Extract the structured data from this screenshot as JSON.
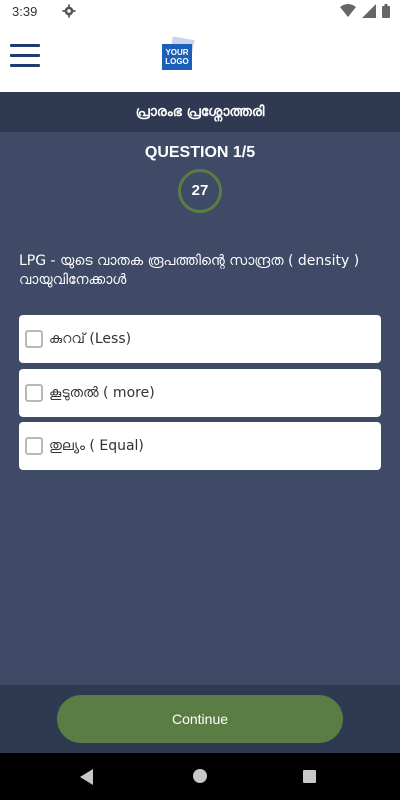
{
  "status_bar": {
    "time": "3:39",
    "icons": [
      "settings-gear-icon",
      "wifi-icon",
      "signal-icon",
      "battery-icon"
    ]
  },
  "header": {
    "menu_icon": "hamburger-menu-icon",
    "logo_text": "YOUR LOGO"
  },
  "title_bar": {
    "title": "പ്രാരംഭ പ്രശ്നോത്തരി"
  },
  "quiz": {
    "question_label": "QUESTION 1/5",
    "timer_value": "27",
    "question_text": "LPG - യുടെ വാതക രൂപത്തിന്റെ സാന്ദ്രത ( density ) വായുവിനേക്കാൾ",
    "options": [
      {
        "label": "കുറവ്  (Less)",
        "checked": false
      },
      {
        "label": "കൂടുതൽ  ( more)",
        "checked": false
      },
      {
        "label": "തുല്യം ( Equal)",
        "checked": false
      }
    ]
  },
  "footer": {
    "continue_label": "Continue"
  },
  "colors": {
    "content_bg": "#3f4a66",
    "title_bar_bg": "#2f3a52",
    "accent_green": "#5a7d44",
    "menu_blue": "#1f3a6e",
    "logo_blue": "#1b5fb8"
  }
}
